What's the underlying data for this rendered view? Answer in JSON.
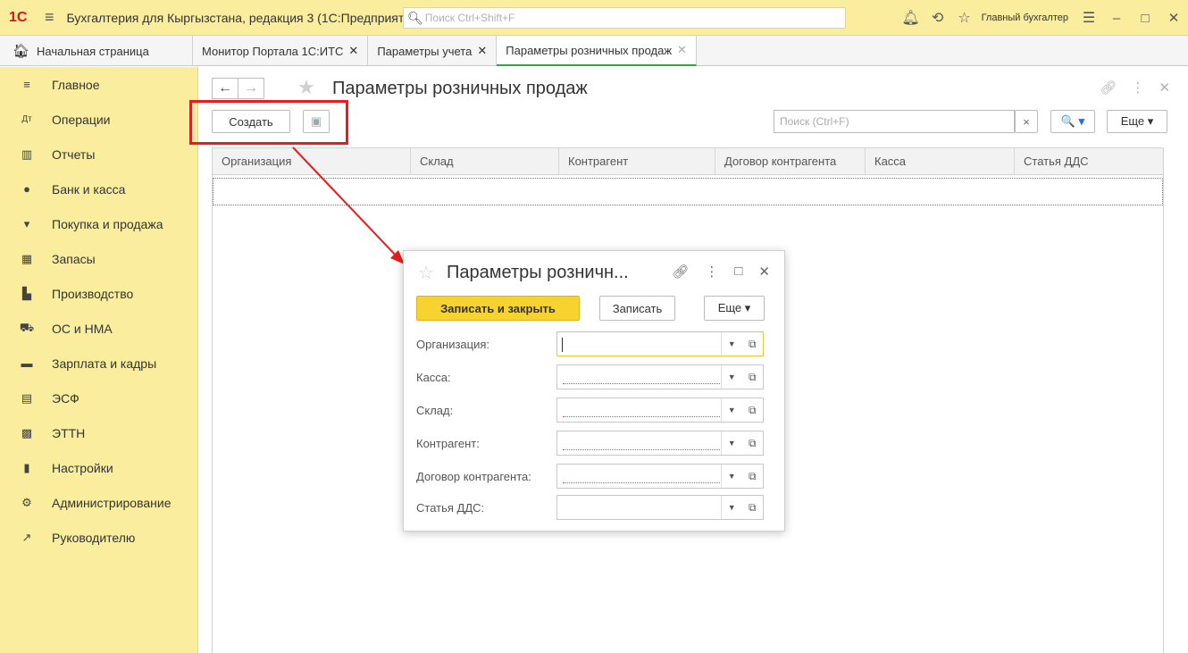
{
  "titlebar": {
    "logo": "1С",
    "title": "Бухгалтерия для Кыргызстана, редакция 3  (1С:Предприятие)",
    "search_placeholder": "Поиск Ctrl+Shift+F",
    "user": "Главный бухгалтер"
  },
  "tabs": [
    {
      "label": "Начальная страница"
    },
    {
      "label": "Монитор Портала 1С:ИТС"
    },
    {
      "label": "Параметры учета"
    },
    {
      "label": "Параметры розничных продаж"
    }
  ],
  "sidebar": {
    "items": [
      {
        "label": "Главное",
        "icon": "menu-lines-icon"
      },
      {
        "label": "Операции",
        "icon": "operations-icon"
      },
      {
        "label": "Отчеты",
        "icon": "bar-chart-icon"
      },
      {
        "label": "Банк и касса",
        "icon": "coin-icon"
      },
      {
        "label": "Покупка и продажа",
        "icon": "cart-icon"
      },
      {
        "label": "Запасы",
        "icon": "warehouse-icon"
      },
      {
        "label": "Производство",
        "icon": "factory-icon"
      },
      {
        "label": "ОС и НМА",
        "icon": "truck-icon"
      },
      {
        "label": "Зарплата и кадры",
        "icon": "card-icon"
      },
      {
        "label": "ЭСФ",
        "icon": "invoice-icon"
      },
      {
        "label": "ЭТТН",
        "icon": "waybill-icon"
      },
      {
        "label": "Настройки",
        "icon": "settings-building-icon"
      },
      {
        "label": "Администрирование",
        "icon": "gear-icon"
      },
      {
        "label": "Руководителю",
        "icon": "trend-icon"
      }
    ]
  },
  "main": {
    "title": "Параметры розничных продаж",
    "create_label": "Создать",
    "search_placeholder": "Поиск (Ctrl+F)",
    "clear_label": "×",
    "search_btn_label": "🔍 ▾",
    "more_label": "Еще ▾",
    "columns": [
      "Организация",
      "Склад",
      "Контрагент",
      "Договор контрагента",
      "Касса",
      "Статья ДДС"
    ]
  },
  "dialog": {
    "title": "Параметры розничн...",
    "save_close_label": "Записать и закрыть",
    "save_label": "Записать",
    "more_label": "Еще ▾",
    "fields": [
      {
        "label": "Организация:",
        "value": ""
      },
      {
        "label": "Касса:",
        "value": ""
      },
      {
        "label": "Склад:",
        "value": ""
      },
      {
        "label": "Контрагент:",
        "value": ""
      },
      {
        "label": "Договор контрагента:",
        "value": ""
      },
      {
        "label": "Статья ДДС:",
        "value": ""
      }
    ]
  },
  "colors": {
    "panel_yellow": "#fbed9e",
    "accent_yellow": "#f7d330",
    "highlight_red": "#e41e1e",
    "active_tab_green": "#3a9e4d"
  }
}
